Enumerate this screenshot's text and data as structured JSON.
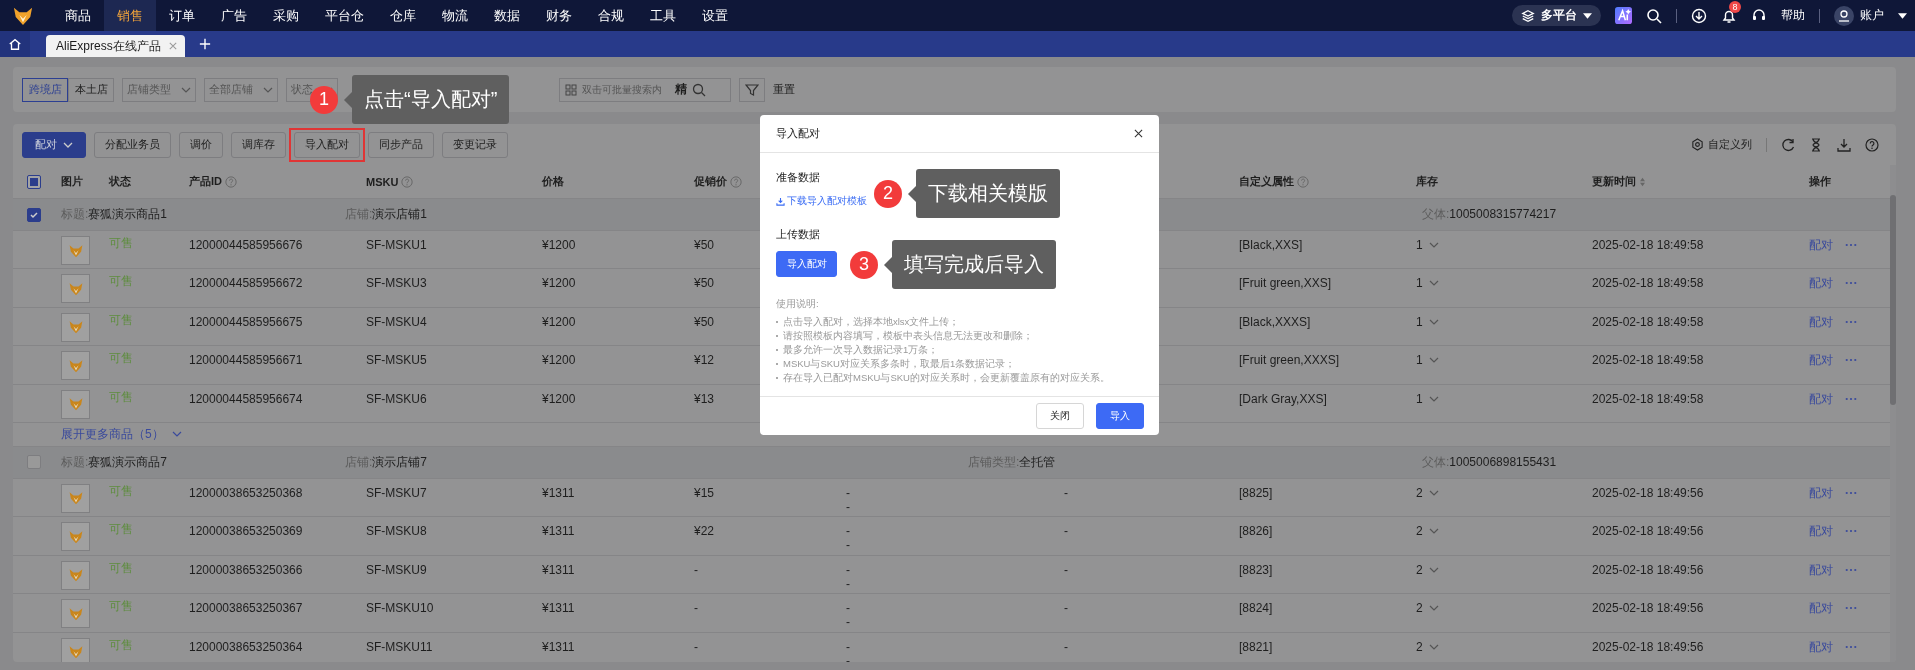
{
  "nav": {
    "items": [
      {
        "label": "商品",
        "selected": false
      },
      {
        "label": "销售",
        "selected": true
      },
      {
        "label": "订单",
        "selected": false
      },
      {
        "label": "广告",
        "selected": false
      },
      {
        "label": "采购",
        "selected": false
      },
      {
        "label": "平台仓",
        "selected": false
      },
      {
        "label": "仓库",
        "selected": false
      },
      {
        "label": "物流",
        "selected": false
      },
      {
        "label": "数据",
        "selected": false
      },
      {
        "label": "财务",
        "selected": false
      },
      {
        "label": "合规",
        "selected": false
      },
      {
        "label": "工具",
        "selected": false
      },
      {
        "label": "设置",
        "selected": false
      }
    ],
    "platform": "多平台",
    "notification_count": "8",
    "help": "帮助",
    "account": "账户"
  },
  "tabs": [
    {
      "label": "AliExpress在线产品",
      "selected": true
    }
  ],
  "filters": {
    "shop_scope": [
      {
        "label": "跨境店",
        "selected": true
      },
      {
        "label": "本土店",
        "selected": false
      }
    ],
    "dropdowns": [
      "店铺类型",
      "全部店铺",
      "状态"
    ],
    "search": {
      "placeholder": "双击可批量搜索内",
      "exact": "精"
    },
    "reset": "重置"
  },
  "toolbar": {
    "buttons": [
      {
        "label": "配对",
        "kind": "primary",
        "highlighted": false
      },
      {
        "label": "分配业务员",
        "kind": "default",
        "highlighted": false
      },
      {
        "label": "调价",
        "kind": "default",
        "highlighted": false
      },
      {
        "label": "调库存",
        "kind": "default",
        "highlighted": false
      },
      {
        "label": "导入配对",
        "kind": "default",
        "highlighted": true
      },
      {
        "label": "同步产品",
        "kind": "default",
        "highlighted": false
      },
      {
        "label": "变更记录",
        "kind": "default",
        "highlighted": false
      }
    ],
    "custom_columns": "自定义列"
  },
  "table": {
    "select_all": {
      "checked": false,
      "indeterminate": true
    },
    "columns": [
      {
        "label": "图片"
      },
      {
        "label": "状态"
      },
      {
        "label": "产品ID",
        "help": true
      },
      {
        "label": "MSKU",
        "help": true
      },
      {
        "label": "价格"
      },
      {
        "label": "促销价",
        "help": true
      },
      {
        "label": "自定义属性",
        "help": true
      },
      {
        "label": "库存"
      },
      {
        "label": "更新时间",
        "sortable": true
      },
      {
        "label": "操作"
      }
    ],
    "groups": [
      {
        "checked": true,
        "title_label": "标题:",
        "title": "赛狐演示商品1",
        "store_label": "店铺:",
        "store": "演示店铺1",
        "parent_label": "父体:",
        "parent": "1005008315774217",
        "expand": "展开更多商品（5）",
        "rows": [
          {
            "status": "可售",
            "product_id": "12000044585956676",
            "msku": "SF-MSKU1",
            "price": "¥1200",
            "promo_price": "¥50",
            "attributes": "[Black,XXS]",
            "stock": "1",
            "updated": "2025-02-18 18:49:58",
            "action": "配对"
          },
          {
            "status": "可售",
            "product_id": "12000044585956672",
            "msku": "SF-MSKU3",
            "price": "¥1200",
            "promo_price": "¥50",
            "attributes": "[Fruit green,XXS]",
            "stock": "1",
            "updated": "2025-02-18 18:49:58",
            "action": "配对"
          },
          {
            "status": "可售",
            "product_id": "12000044585956675",
            "msku": "SF-MSKU4",
            "price": "¥1200",
            "promo_price": "¥50",
            "attributes": "[Black,XXXS]",
            "stock": "1",
            "updated": "2025-02-18 18:49:58",
            "action": "配对"
          },
          {
            "status": "可售",
            "product_id": "12000044585956671",
            "msku": "SF-MSKU5",
            "price": "¥1200",
            "promo_price": "¥12",
            "attributes": "[Fruit green,XXXS]",
            "stock": "1",
            "updated": "2025-02-18 18:49:58",
            "action": "配对"
          },
          {
            "status": "可售",
            "product_id": "12000044585956674",
            "msku": "SF-MSKU6",
            "price": "¥1200",
            "promo_price": "¥13",
            "attributes": "[Dark Gray,XXS]",
            "stock": "1",
            "updated": "2025-02-18 18:49:58",
            "action": "配对"
          }
        ]
      },
      {
        "checked": false,
        "title_label": "标题:",
        "title": "赛狐演示商品7",
        "store_label": "店铺:",
        "store": "演示店铺7",
        "store_type_label": "店铺类型:",
        "store_type": "全托管",
        "parent_label": "父体:",
        "parent": "1005006898155431",
        "rows": [
          {
            "status": "可售",
            "product_id": "12000038653250368",
            "msku": "SF-MSKU7",
            "price": "¥1311",
            "promo_price": "¥15",
            "column_7": [
              "-",
              "-"
            ],
            "column_8": "-",
            "attributes": "[8825]",
            "stock": "2",
            "updated": "2025-02-18 18:49:56",
            "action": "配对"
          },
          {
            "status": "可售",
            "product_id": "12000038653250369",
            "msku": "SF-MSKU8",
            "price": "¥1311",
            "promo_price": "¥22",
            "column_7": [
              "-",
              "-"
            ],
            "column_8": "-",
            "attributes": "[8826]",
            "stock": "2",
            "updated": "2025-02-18 18:49:56",
            "action": "配对"
          },
          {
            "status": "可售",
            "product_id": "12000038653250366",
            "msku": "SF-MSKU9",
            "price": "¥1311",
            "promo_price": "-",
            "column_7": [
              "-",
              "-"
            ],
            "column_8": "-",
            "attributes": "[8823]",
            "stock": "2",
            "updated": "2025-02-18 18:49:56",
            "action": "配对"
          },
          {
            "status": "可售",
            "product_id": "12000038653250367",
            "msku": "SF-MSKU10",
            "price": "¥1311",
            "promo_price": "-",
            "column_7": [
              "-",
              "-"
            ],
            "column_8": "-",
            "attributes": "[8824]",
            "stock": "2",
            "updated": "2025-02-18 18:49:56",
            "action": "配对"
          },
          {
            "status": "可售",
            "product_id": "12000038653250364",
            "msku": "SF-MSKU11",
            "price": "¥1311",
            "promo_price": "-",
            "column_7": [
              "-",
              "-"
            ],
            "column_8": "-",
            "attributes": "[8821]",
            "stock": "2",
            "updated": "2025-02-18 18:49:56",
            "action": "配对"
          }
        ]
      }
    ]
  },
  "modal": {
    "title": "导入配对",
    "prepare_heading": "准备数据",
    "template_link": "下载导入配对模板",
    "upload_heading": "上传数据",
    "upload_button": "导入配对",
    "instructions_title": "使用说明:",
    "instructions": [
      "点击导入配对，选择本地xlsx文件上传；",
      "请按照模板内容填写，模板中表头信息无法更改和删除；",
      "最多允许一次导入数据记录1万条；",
      "MSKU与SKU对应关系多条时，取最后1条数据记录；",
      "存在导入已配对MSKU与SKU的对应关系时，会更新覆盖原有的对应关系。"
    ],
    "buttons": [
      {
        "label": "关闭",
        "kind": "default"
      },
      {
        "label": "导入",
        "kind": "primary"
      }
    ]
  },
  "callouts": [
    {
      "number": "1",
      "text": "点击“导入配对”"
    },
    {
      "number": "2",
      "text": "下载相关模版"
    },
    {
      "number": "3",
      "text": "填写完成后导入"
    }
  ]
}
